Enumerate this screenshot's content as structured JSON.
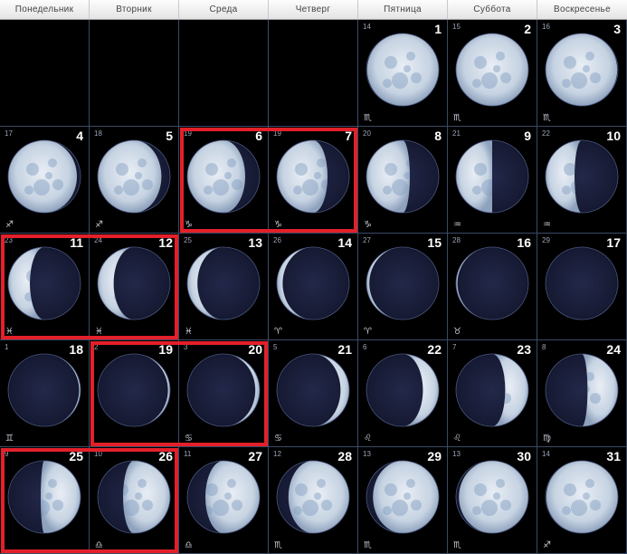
{
  "weekdays": [
    "Понедельник",
    "Вторник",
    "Среда",
    "Четверг",
    "Пятница",
    "Суббота",
    "Воскресенье"
  ],
  "days": [
    {
      "day": "1",
      "lunar": "14",
      "zodiac": "♏",
      "lit": 0.99,
      "side": "R"
    },
    {
      "day": "2",
      "lunar": "15",
      "zodiac": "♏",
      "lit": 1.0,
      "side": "R"
    },
    {
      "day": "3",
      "lunar": "16",
      "zodiac": "♏",
      "lit": 0.99,
      "side": "L"
    },
    {
      "day": "4",
      "lunar": "17",
      "zodiac": "♐",
      "lit": 0.95,
      "side": "L"
    },
    {
      "day": "5",
      "lunar": "18",
      "zodiac": "♐",
      "lit": 0.88,
      "side": "L"
    },
    {
      "day": "6",
      "lunar": "19",
      "zodiac": "♑",
      "lit": 0.8,
      "side": "L"
    },
    {
      "day": "7",
      "lunar": "19",
      "zodiac": "♑",
      "lit": 0.7,
      "side": "L"
    },
    {
      "day": "8",
      "lunar": "20",
      "zodiac": "♑",
      "lit": 0.6,
      "side": "L"
    },
    {
      "day": "9",
      "lunar": "21",
      "zodiac": "♒",
      "lit": 0.5,
      "side": "L"
    },
    {
      "day": "10",
      "lunar": "22",
      "zodiac": "♒",
      "lit": 0.4,
      "side": "L"
    },
    {
      "day": "11",
      "lunar": "23",
      "zodiac": "♓",
      "lit": 0.3,
      "side": "L"
    },
    {
      "day": "12",
      "lunar": "24",
      "zodiac": "♓",
      "lit": 0.22,
      "side": "L"
    },
    {
      "day": "13",
      "lunar": "25",
      "zodiac": "♓",
      "lit": 0.14,
      "side": "L"
    },
    {
      "day": "14",
      "lunar": "26",
      "zodiac": "♈",
      "lit": 0.08,
      "side": "L"
    },
    {
      "day": "15",
      "lunar": "27",
      "zodiac": "♈",
      "lit": 0.04,
      "side": "L"
    },
    {
      "day": "16",
      "lunar": "28",
      "zodiac": "♉",
      "lit": 0.02,
      "side": "L"
    },
    {
      "day": "17",
      "lunar": "29",
      "zodiac": "",
      "lit": 0.0,
      "side": "L"
    },
    {
      "day": "18",
      "lunar": "1",
      "zodiac": "♊",
      "lit": 0.02,
      "side": "R"
    },
    {
      "day": "19",
      "lunar": "2",
      "zodiac": "",
      "lit": 0.03,
      "side": "R"
    },
    {
      "day": "20",
      "lunar": "3",
      "zodiac": "♋",
      "lit": 0.06,
      "side": "R"
    },
    {
      "day": "21",
      "lunar": "5",
      "zodiac": "♋",
      "lit": 0.12,
      "side": "R"
    },
    {
      "day": "22",
      "lunar": "6",
      "zodiac": "♌",
      "lit": 0.22,
      "side": "R"
    },
    {
      "day": "23",
      "lunar": "7",
      "zodiac": "♌",
      "lit": 0.32,
      "side": "R"
    },
    {
      "day": "24",
      "lunar": "8",
      "zodiac": "♍",
      "lit": 0.42,
      "side": "R"
    },
    {
      "day": "25",
      "lunar": "9",
      "zodiac": "",
      "lit": 0.55,
      "side": "R"
    },
    {
      "day": "26",
      "lunar": "10",
      "zodiac": "♎",
      "lit": 0.65,
      "side": "R"
    },
    {
      "day": "27",
      "lunar": "11",
      "zodiac": "♎",
      "lit": 0.75,
      "side": "R"
    },
    {
      "day": "28",
      "lunar": "12",
      "zodiac": "♏",
      "lit": 0.84,
      "side": "R"
    },
    {
      "day": "29",
      "lunar": "13",
      "zodiac": "♏",
      "lit": 0.91,
      "side": "R"
    },
    {
      "day": "30",
      "lunar": "13",
      "zodiac": "♏",
      "lit": 0.96,
      "side": "R"
    },
    {
      "day": "31",
      "lunar": "14",
      "zodiac": "♐",
      "lit": 0.99,
      "side": "R"
    }
  ],
  "highlight_color": "#e3202a",
  "highlighted_days": [
    "6",
    "7",
    "11",
    "12",
    "19",
    "20",
    "25",
    "26"
  ]
}
